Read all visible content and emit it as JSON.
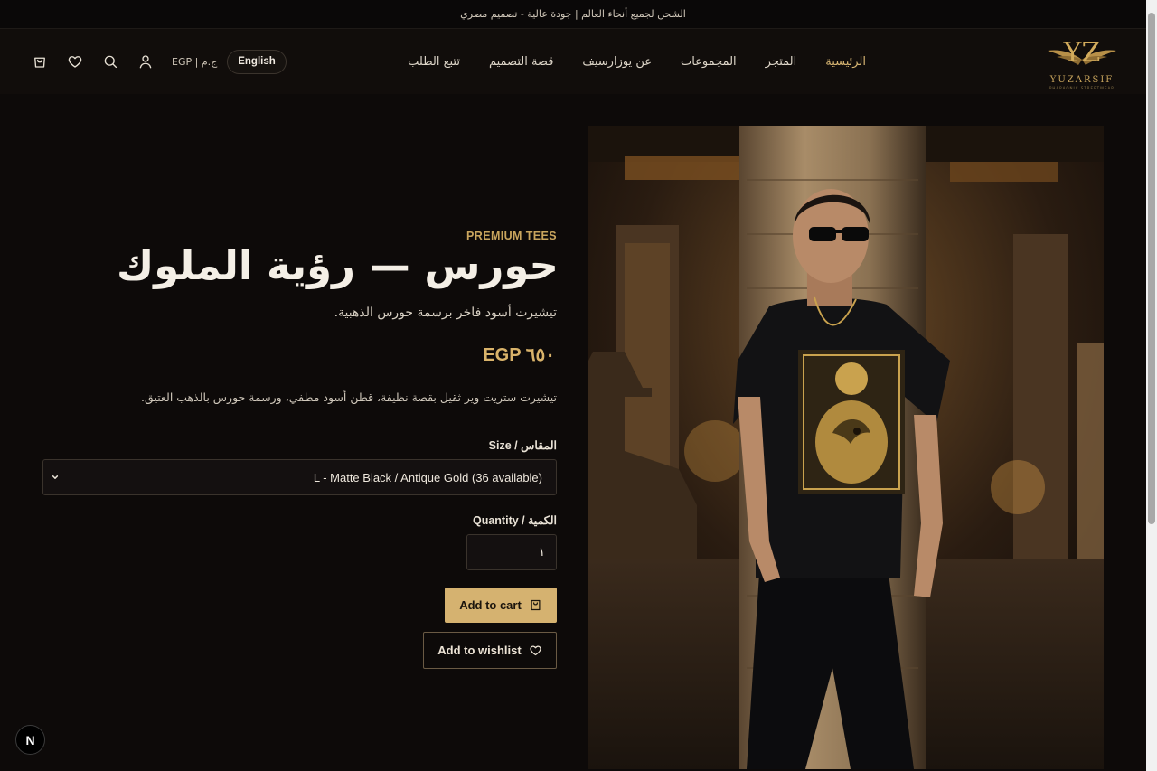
{
  "announcement": "الشحن لجميع أنحاء العالم | جودة عالية - تصميم مصري",
  "header": {
    "logo_text": "YUZARSIF",
    "logo_tagline": "PHARAONIC STREETWEAR",
    "nav": [
      {
        "label": "الرئيسية",
        "active": true
      },
      {
        "label": "المتجر",
        "active": false
      },
      {
        "label": "المجموعات",
        "active": false
      },
      {
        "label": "عن يوزارسيف",
        "active": false
      },
      {
        "label": "قصة التصميم",
        "active": false
      },
      {
        "label": "تتبع الطلب",
        "active": false
      }
    ],
    "currency": "EGP | ج.م",
    "language_button": "English",
    "icons": [
      "cart-icon",
      "heart-icon",
      "search-icon",
      "user-icon"
    ]
  },
  "product": {
    "category": "PREMIUM TEES",
    "title": "حورس — رؤية الملوك",
    "subtitle": "تيشيرت أسود فاخر برسمة حورس الذهبية.",
    "price": "EGP ٦٥٠",
    "description": "تيشيرت ستريت وير ثقيل بقصة نظيفة، قطن أسود مطفي، ورسمة حورس بالذهب العتيق.",
    "size_label": "Size / المقاس",
    "size_selected": "L - Matte Black / Antique Gold (36 available)",
    "quantity_label": "Quantity / الكمية",
    "quantity_value": "١",
    "add_to_cart": "Add to cart",
    "add_to_wishlist": "Add to wishlist"
  },
  "floating_badge": "N",
  "colors": {
    "background": "#0d0a09",
    "accent_gold": "#d5b270",
    "text": "#e9e2d6"
  }
}
